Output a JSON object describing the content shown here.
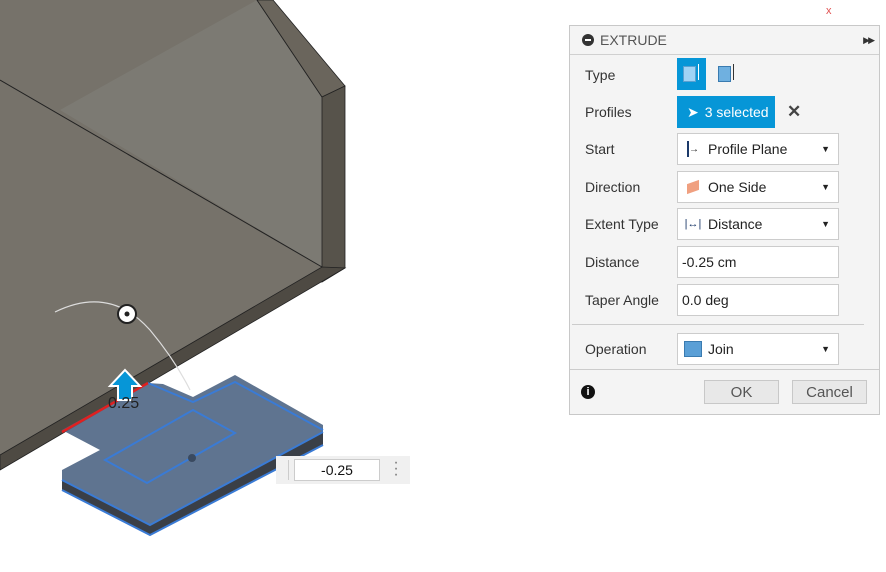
{
  "viewport": {
    "dimension_value": "-0.25",
    "dimension_label": "0.25"
  },
  "panel": {
    "title": "EXTRUDE",
    "type_label": "Type",
    "profiles_label": "Profiles",
    "profiles_value": "3 selected",
    "start_label": "Start",
    "start_value": "Profile Plane",
    "direction_label": "Direction",
    "direction_value": "One Side",
    "extent_label": "Extent Type",
    "extent_value": "Distance",
    "distance_label": "Distance",
    "distance_value": "-0.25 cm",
    "taper_label": "Taper Angle",
    "taper_value": "0.0 deg",
    "operation_label": "Operation",
    "operation_value": "Join",
    "ok_label": "OK",
    "cancel_label": "Cancel"
  },
  "colors": {
    "accent": "#0696d7",
    "selection_blue": "#3a7bd5",
    "body": "#7a756b"
  }
}
